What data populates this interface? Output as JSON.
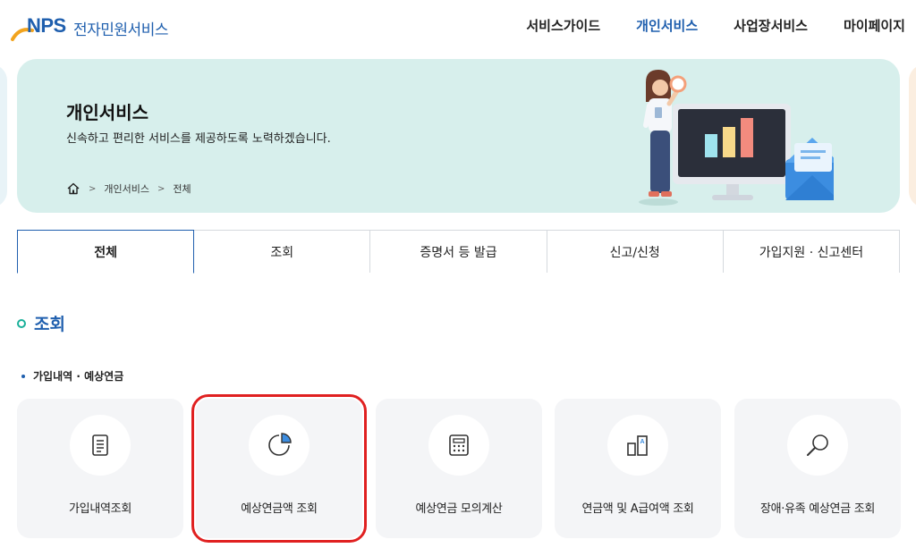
{
  "header": {
    "logo_text": "NPS",
    "site_title": "전자민원서비스",
    "nav": [
      {
        "label": "서비스가이드",
        "active": false
      },
      {
        "label": "개인서비스",
        "active": true
      },
      {
        "label": "사업장서비스",
        "active": false
      },
      {
        "label": "마이페이지",
        "active": false
      }
    ]
  },
  "banner": {
    "title": "개인서비스",
    "subtitle": "신속하고 편리한 서비스를 제공하도록 노력하겠습니다.",
    "breadcrumb": [
      "개인서비스",
      "전체"
    ]
  },
  "tabs": [
    {
      "label": "전체",
      "active": true
    },
    {
      "label": "조회",
      "active": false
    },
    {
      "label": "증명서 등 발급",
      "active": false
    },
    {
      "label": "신고/신청",
      "active": false
    },
    {
      "label": "가입지원 · 신고센터",
      "active": false
    }
  ],
  "section": {
    "title": "조회",
    "subtitle": "가입내역 · 예상연금"
  },
  "cards": [
    {
      "label": "가입내역조회",
      "icon": "document-icon",
      "highlighted": false
    },
    {
      "label": "예상연금액 조회",
      "icon": "pie-chart-icon",
      "highlighted": true
    },
    {
      "label": "예상연금 모의계산",
      "icon": "calculator-icon",
      "highlighted": false
    },
    {
      "label": "연금액 및 A급여액 조회",
      "icon": "compare-bars-icon",
      "highlighted": false
    },
    {
      "label": "장애·유족 예상연금 조회",
      "icon": "magnifier-icon",
      "highlighted": false
    }
  ],
  "colors": {
    "brand": "#1f5fae",
    "accent": "#1ab09a",
    "banner_bg": "#d7efec",
    "highlight": "#e02020"
  }
}
